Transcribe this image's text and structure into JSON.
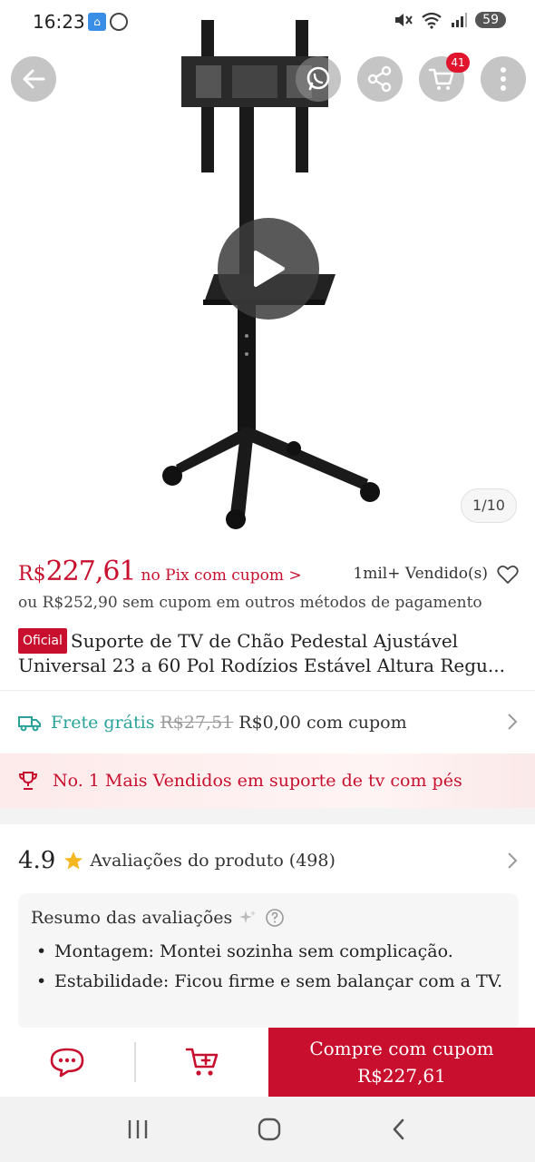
{
  "status_bar": {
    "time": "16:23",
    "battery": "59"
  },
  "gallery": {
    "counter": "1/10",
    "cart_count": "41"
  },
  "price": {
    "currency": "R$",
    "value": "227,61",
    "pix_link": "no Pix com cupom >",
    "sold": "1mil+ Vendido(s)",
    "alt_price": "ou R$252,90 sem cupom em outros métodos de pagamento"
  },
  "product": {
    "badge": "Oficial",
    "title": "Suporte de TV de Chão Pedestal Ajustável Universal 23 a 60 Pol Rodízios Estável Altura Regu..."
  },
  "shipping": {
    "label": "Frete grátis",
    "old_price": "R$27,51",
    "new_price": "R$0,00 com cupom"
  },
  "bestseller": {
    "text": "No. 1 Mais Vendidos em suporte de tv com pés"
  },
  "rating": {
    "score": "4.9",
    "label": "Avaliações do produto",
    "count": "(498)"
  },
  "summary": {
    "title": "Resumo das avaliações",
    "items": [
      "Montagem: Montei sozinha sem complicação.",
      "Estabilidade: Ficou firme e sem balançar com a TV."
    ]
  },
  "action_bar": {
    "buy_line1": "Compre com cupom",
    "buy_line2": "R$227,61"
  },
  "colors": {
    "accent": "#c8102e",
    "shipping": "#29a39a"
  },
  "icons": [
    "back-arrow-icon",
    "whatsapp-icon",
    "share-icon",
    "cart-icon",
    "more-icon",
    "play-icon",
    "heart-icon",
    "truck-icon",
    "trophy-icon",
    "star-icon",
    "sparkle-icon",
    "help-icon",
    "chat-icon",
    "add-to-cart-icon",
    "recent-apps-icon",
    "home-icon",
    "nav-back-icon"
  ]
}
